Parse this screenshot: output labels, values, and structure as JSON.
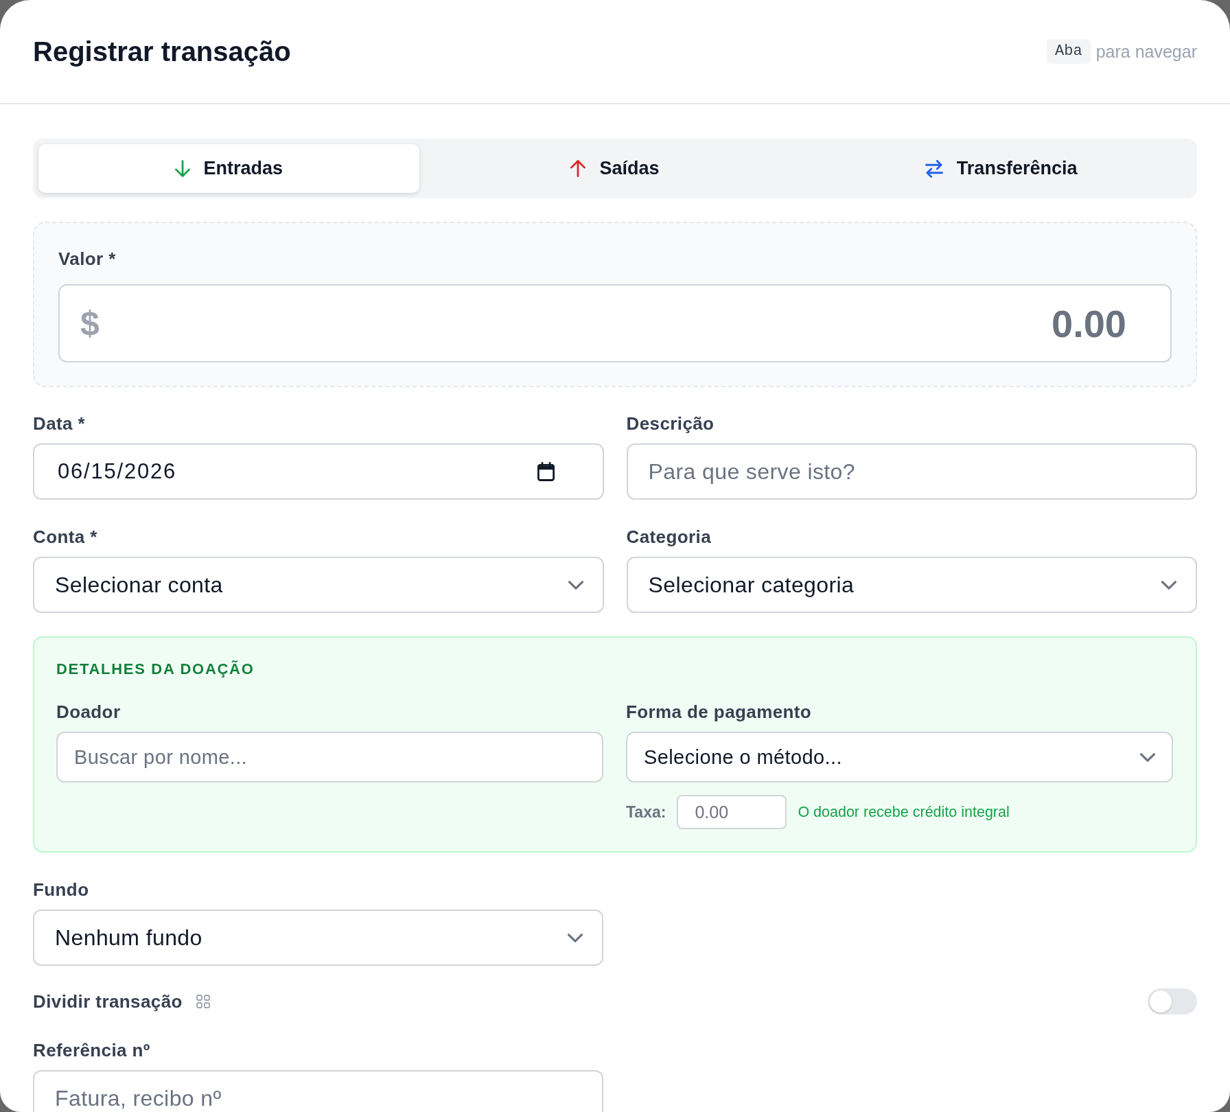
{
  "dialog": {
    "title": "Registrar transação",
    "hint_key": "Aba",
    "hint_text": "para navegar"
  },
  "tabs": [
    {
      "label": "Entradas",
      "kind": "income",
      "selected": true
    },
    {
      "label": "Saídas",
      "kind": "expense",
      "selected": false
    },
    {
      "label": "Transferência",
      "kind": "transfer",
      "selected": false
    }
  ],
  "amount": {
    "label": "Valor *",
    "currency": "$",
    "placeholder": "0.00"
  },
  "date": {
    "label": "Data *",
    "value": "06/15/2026"
  },
  "description": {
    "label": "Descrição",
    "placeholder": "Para que serve isto?"
  },
  "account": {
    "label": "Conta *",
    "value": "Selecionar conta"
  },
  "category": {
    "label": "Categoria",
    "value": "Selecionar categoria"
  },
  "donation": {
    "title": "DETALHES DA DOAÇÃO",
    "donor": {
      "label": "Doador",
      "placeholder": "Buscar por nome..."
    },
    "payment_method": {
      "label": "Forma de pagamento",
      "value": "Selecione o método..."
    },
    "fee": {
      "label": "Taxa:",
      "placeholder": "0.00",
      "note": "O doador recebe crédito integral"
    }
  },
  "fund": {
    "label": "Fundo",
    "value": "Nenhum fundo"
  },
  "split": {
    "label": "Dividir transação",
    "on": false
  },
  "reference": {
    "label": "Referência nº",
    "placeholder": "Fatura, recibo nº"
  }
}
